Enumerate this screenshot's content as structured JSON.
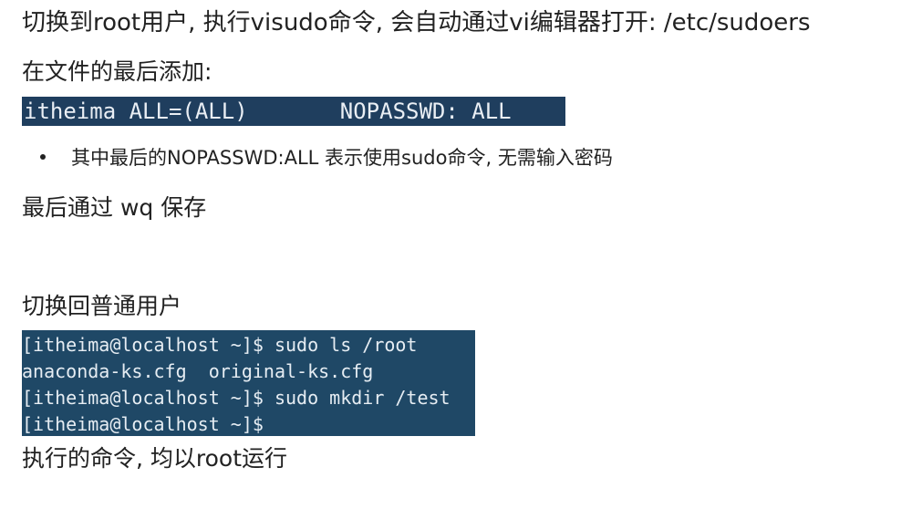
{
  "heading_switch_root": "切换到root用户, 执行visudo命令, 会自动通过vi编辑器打开: /etc/sudoers",
  "heading_append": "在文件的最后添加:",
  "sudoers_line": "itheima ALL=(ALL)       NOPASSWD: ALL",
  "bullet_note": "其中最后的NOPASSWD:ALL 表示使用sudo命令, 无需输入密码",
  "save_note": "最后通过 wq 保存",
  "heading_switch_user": "切换回普通用户",
  "terminal_lines": [
    "[itheima@localhost ~]$ sudo ls /root",
    "anaconda-ks.cfg  original-ks.cfg",
    "[itheima@localhost ~]$ sudo mkdir /test",
    "[itheima@localhost ~]$"
  ],
  "footer_note": "执行的命令, 均以root运行",
  "colors": {
    "terminal_bg_top": "#1f3e5e",
    "terminal_bg_bottom": "#1f4866",
    "terminal_text": "#e9eef4",
    "body_text": "#222222"
  }
}
